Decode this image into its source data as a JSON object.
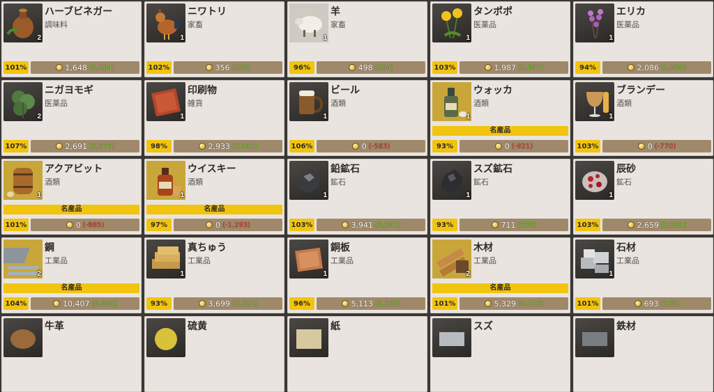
{
  "items": [
    {
      "name": "ハーブビネガー",
      "category": "調味料",
      "qty": "2",
      "percent": "101%",
      "price": "1,648",
      "diff": "(1,424)",
      "diff_sign": "pos",
      "specialty": "",
      "icon": "vinegar-jug-icon"
    },
    {
      "name": "ニワトリ",
      "category": "家畜",
      "qty": "1",
      "percent": "102%",
      "price": "356",
      "diff": "(225)",
      "diff_sign": "pos",
      "specialty": "",
      "icon": "chicken-icon"
    },
    {
      "name": "羊",
      "category": "家畜",
      "qty": "1",
      "percent": "96%",
      "price": "498",
      "diff": "(204)",
      "diff_sign": "pos",
      "specialty": "",
      "icon": "sheep-icon"
    },
    {
      "name": "タンポポ",
      "category": "医薬品",
      "qty": "1",
      "percent": "103%",
      "price": "1,987",
      "diff": "(1,697)",
      "diff_sign": "pos",
      "specialty": "",
      "icon": "dandelion-icon"
    },
    {
      "name": "エリカ",
      "category": "医薬品",
      "qty": "1",
      "percent": "94%",
      "price": "2,086",
      "diff": "(1,834)",
      "diff_sign": "pos",
      "specialty": "",
      "icon": "heather-icon"
    },
    {
      "name": "ニガヨモギ",
      "category": "医薬品",
      "qty": "2",
      "percent": "107%",
      "price": "2,691",
      "diff": "(2,376)",
      "diff_sign": "pos",
      "specialty": "",
      "icon": "wormwood-icon"
    },
    {
      "name": "印刷物",
      "category": "雑貨",
      "qty": "1",
      "percent": "98%",
      "price": "2,933",
      "diff": "(2,417)",
      "diff_sign": "pos",
      "specialty": "",
      "icon": "book-icon"
    },
    {
      "name": "ビール",
      "category": "酒類",
      "qty": "1",
      "percent": "106%",
      "price": "0",
      "diff": "(-583)",
      "diff_sign": "neg",
      "specialty": "",
      "icon": "beer-mug-icon"
    },
    {
      "name": "ウォッカ",
      "category": "酒類",
      "qty": "1",
      "percent": "93%",
      "price": "0",
      "diff": "(-921)",
      "diff_sign": "neg",
      "specialty": "名産品",
      "icon": "vodka-bottle-icon"
    },
    {
      "name": "ブランデー",
      "category": "酒類",
      "qty": "1",
      "percent": "103%",
      "price": "0",
      "diff": "(-770)",
      "diff_sign": "neg",
      "specialty": "",
      "icon": "brandy-glass-icon"
    },
    {
      "name": "アクアビット",
      "category": "酒類",
      "qty": "1",
      "percent": "101%",
      "price": "0",
      "diff": "(-885)",
      "diff_sign": "neg",
      "specialty": "名産品",
      "icon": "barrel-icon"
    },
    {
      "name": "ウイスキー",
      "category": "酒類",
      "qty": "1",
      "percent": "97%",
      "price": "0",
      "diff": "(-1,293)",
      "diff_sign": "neg",
      "specialty": "名産品",
      "icon": "whiskey-icon"
    },
    {
      "name": "鉛鉱石",
      "category": "鉱石",
      "qty": "1",
      "percent": "103%",
      "price": "3,941",
      "diff": "(3,241)",
      "diff_sign": "pos",
      "specialty": "",
      "icon": "lead-ore-icon"
    },
    {
      "name": "スズ鉱石",
      "category": "鉱石",
      "qty": "1",
      "percent": "93%",
      "price": "711",
      "diff": "(379)",
      "diff_sign": "pos",
      "specialty": "",
      "icon": "tin-ore-icon"
    },
    {
      "name": "辰砂",
      "category": "鉱石",
      "qty": "1",
      "percent": "103%",
      "price": "2,659",
      "diff": "(2,224)",
      "diff_sign": "pos",
      "specialty": "",
      "icon": "cinnabar-icon"
    },
    {
      "name": "鋼",
      "category": "工業品",
      "qty": "2",
      "percent": "104%",
      "price": "10,407",
      "diff": "(8,824)",
      "diff_sign": "pos",
      "specialty": "名産品",
      "icon": "steel-icon"
    },
    {
      "name": "真ちゅう",
      "category": "工業品",
      "qty": "1",
      "percent": "93%",
      "price": "3,699",
      "diff": "(3,021)",
      "diff_sign": "pos",
      "specialty": "",
      "icon": "brass-ingot-icon"
    },
    {
      "name": "銅板",
      "category": "工業品",
      "qty": "1",
      "percent": "96%",
      "price": "5,113",
      "diff": "(4,329)",
      "diff_sign": "pos",
      "specialty": "",
      "icon": "copper-plate-icon"
    },
    {
      "name": "木材",
      "category": "工業品",
      "qty": "2",
      "percent": "101%",
      "price": "5,329",
      "diff": "(4,719)",
      "diff_sign": "pos",
      "specialty": "名産品",
      "icon": "lumber-icon"
    },
    {
      "name": "石材",
      "category": "工業品",
      "qty": "1",
      "percent": "101%",
      "price": "693",
      "diff": "(160)",
      "diff_sign": "pos",
      "specialty": "",
      "icon": "stone-icon"
    },
    {
      "name": "牛革",
      "category": "",
      "qty": "",
      "percent": "",
      "price": "",
      "diff": "",
      "diff_sign": "pos",
      "specialty": "",
      "icon": "leather-icon"
    },
    {
      "name": "硫黄",
      "category": "",
      "qty": "",
      "percent": "",
      "price": "",
      "diff": "",
      "diff_sign": "pos",
      "specialty": "",
      "icon": "sulfur-icon"
    },
    {
      "name": "紙",
      "category": "",
      "qty": "",
      "percent": "",
      "price": "",
      "diff": "",
      "diff_sign": "pos",
      "specialty": "",
      "icon": "paper-icon"
    },
    {
      "name": "スズ",
      "category": "",
      "qty": "",
      "percent": "",
      "price": "",
      "diff": "",
      "diff_sign": "pos",
      "specialty": "",
      "icon": "tin-ingot-icon"
    },
    {
      "name": "鉄材",
      "category": "",
      "qty": "",
      "percent": "",
      "price": "",
      "diff": "",
      "diff_sign": "pos",
      "specialty": "",
      "icon": "iron-icon"
    }
  ],
  "colors": {
    "card_bg": "#e9e4df",
    "percent_bg": "#f1c40f",
    "price_bg": "#a0896b",
    "specialty_bg": "#f1c40f",
    "positive": "#7ddc2f",
    "negative": "#e04a3a"
  }
}
